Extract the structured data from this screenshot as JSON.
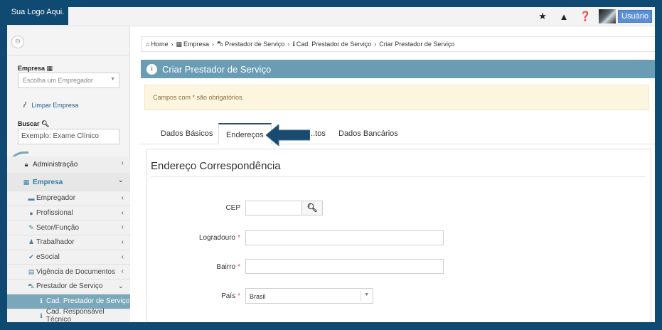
{
  "topbar": {
    "logo_text": "Sua Logo Aqui.",
    "icons": [
      "star-icon",
      "warning-icon",
      "question-icon"
    ],
    "user_button": "Usuário"
  },
  "sidebar": {
    "empresa_label": "Empresa",
    "empresa_placeholder": "Escolha um Empregador",
    "clear_link": "Limpar Empresa",
    "search_label": "Buscar",
    "search_value": "Exemplo: Exame Clínico",
    "menu": [
      {
        "label": "Administração",
        "icon": "lock-icon"
      },
      {
        "label": "Empresa",
        "icon": "building-icon"
      }
    ],
    "submenu": [
      {
        "label": "Empregador",
        "icon": "briefcase-icon"
      },
      {
        "label": "Profissional",
        "icon": "user-icon"
      },
      {
        "label": "Setor/Função",
        "icon": "wrench-icon"
      },
      {
        "label": "Trabalhador",
        "icon": "person-icon"
      },
      {
        "label": "eSocial",
        "icon": "check-icon"
      },
      {
        "label": "Vigência de Documentos",
        "icon": "calendar-icon"
      },
      {
        "label": "Prestador de Serviço",
        "icon": "car-icon"
      }
    ],
    "subsubmenu": [
      {
        "label": "Cad. Prestador de Serviço",
        "icon": "info-icon",
        "active": true
      },
      {
        "label": "Cad. Responsável Técnico",
        "icon": "info-icon",
        "active": false
      }
    ]
  },
  "breadcrumb": [
    "Home",
    "Empresa",
    "Prestador de Serviço",
    "Cad. Prestador de Serviço",
    "Criar Prestador de Serviço"
  ],
  "panel_title": "Criar Prestador de Serviço",
  "alert_text": "Campos com * são obrigatórios.",
  "tabs": [
    {
      "label": "Dados Básicos",
      "active": false
    },
    {
      "label": "Endereços",
      "active": true
    },
    {
      "label": "...tos",
      "active": false
    },
    {
      "label": "Dados Bancários",
      "active": false
    }
  ],
  "section_title": "Endereço Correspondência",
  "form": {
    "cep_label": "CEP",
    "logradouro_label": "Logradouro",
    "bairro_label": "Bairro",
    "pais_label": "País",
    "pais_value": "Brasil",
    "required_mark": "*"
  },
  "colors": {
    "accent": "#6a9db4",
    "frame": "#0f4a72",
    "arrow": "#1b4a70"
  }
}
